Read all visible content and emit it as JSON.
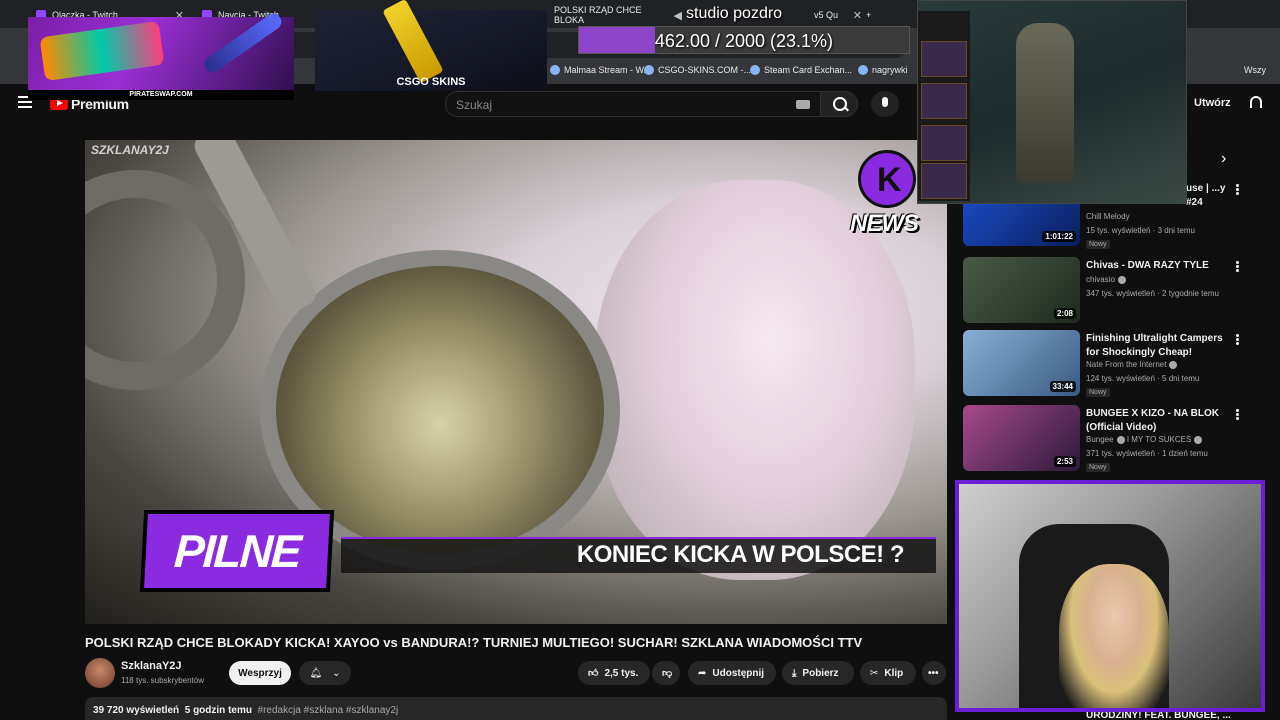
{
  "browser": {
    "tabs": [
      {
        "label": "Olaczka - Twitch"
      },
      {
        "label": "Navcia - Twitch"
      },
      {
        "label": "POLSKI RZĄD CHCE BLOKA"
      },
      {
        "label": "v5 Qu"
      }
    ],
    "bookmarks": [
      "Malmaa Stream - W...",
      "CSGO-SKINS.COM -...",
      "Steam Card Exchan...",
      "nagrywki",
      "Wszy"
    ]
  },
  "youtube": {
    "brand": "Premium",
    "search_placeholder": "Szukaj",
    "create_label": "Utwórz"
  },
  "video": {
    "watermark": "SZKLANAY2J",
    "news_badge": "NEWS",
    "pilne": "PILNE",
    "caption": "KONIEC KICKA W POLSCE! ?",
    "title": "POLSKI RZĄD CHCE BLOKADY KICKA! XAYOO vs BANDURA!? TURNIEJ MULTIEGO! SUCHAR! SZKLANA WIADOMOŚCI TTV",
    "channel": "SzklanaY2J",
    "subscribers": "118 tys. subskrybentów",
    "join_label": "Wesprzyj",
    "likes": "2,5 tys.",
    "share_label": "Udostępnij",
    "download_label": "Pobierz",
    "clip_label": "Klip",
    "views": "39 720 wyświetleń",
    "age": "5 godzin temu",
    "tags": "#redakcja #szklana #szklanay2j"
  },
  "sidebar": [
    {
      "title": "use |\n...y #24",
      "channel": "Chill Melody",
      "meta": "15 tys. wyświetleń · 3 dni temu",
      "duration": "1:01:22",
      "badge": "Nowy",
      "thumb_color": "#1b4fd1"
    },
    {
      "title": "Chivas - DWA RAZY TYLE",
      "channel": "chivasio",
      "meta": "347 tys. wyświetleń · 2 tygodnie temu",
      "duration": "2:08",
      "badge": "",
      "thumb_color": "#3b4a3a"
    },
    {
      "title": "Finishing Ultralight Campers for Shockingly Cheap!",
      "channel": "Nate From the Internet",
      "meta": "124 tys. wyświetleń · 5 dni temu",
      "duration": "33:44",
      "badge": "Nowy",
      "thumb_color": "#5a7aa8"
    },
    {
      "title": "BUNGEE X KIZO - NA BLOK (Official Video)",
      "channel": "Bungee",
      "channel_extra": "I MY TO SUKCES",
      "meta": "371 tys. wyświetleń · 1 dzień temu",
      "duration": "2:53",
      "badge": "Nowy",
      "thumb_color": "#7a3a6a"
    }
  ],
  "sidebar_bottom": "URODZINY! FEAT. BUNGEE, ...",
  "overlay": {
    "gun_url": "PIRATESWAP.COM",
    "csgo_label": "CSGO SKINS",
    "top_text": "studio pozdro",
    "goal_label": "462.00 / 2000 (23.1%)",
    "goal_fraction": 0.231,
    "accent": "#8e44c9"
  }
}
